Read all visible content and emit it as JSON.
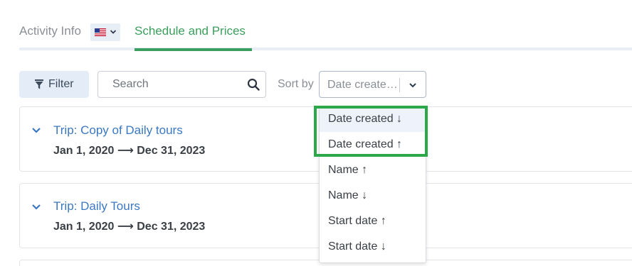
{
  "tabs": {
    "activity_info": "Activity Info",
    "schedule_prices": "Schedule and Prices"
  },
  "language": {
    "flag_icon": "us-flag-icon"
  },
  "toolbar": {
    "filter_label": "Filter",
    "search_placeholder": "Search",
    "sort_label": "Sort by",
    "sort_value": "Date create…"
  },
  "trips": [
    {
      "title": "Trip: Copy of Daily tours",
      "start": "Jan 1, 2020",
      "end": "Dec 31, 2023"
    },
    {
      "title": "Trip: Daily Tours",
      "start": "Jan 1, 2020",
      "end": "Dec 31, 2023"
    }
  ],
  "sort_options": [
    "Date created ↓",
    "Date created ↑",
    "Name ↑",
    "Name ↓",
    "Start date ↑",
    "Start date ↓"
  ],
  "colors": {
    "accent_green": "#3a9e5c",
    "highlight_green": "#2aa84a",
    "link_blue": "#3b78c2",
    "filter_bg": "#e4ecf7"
  }
}
